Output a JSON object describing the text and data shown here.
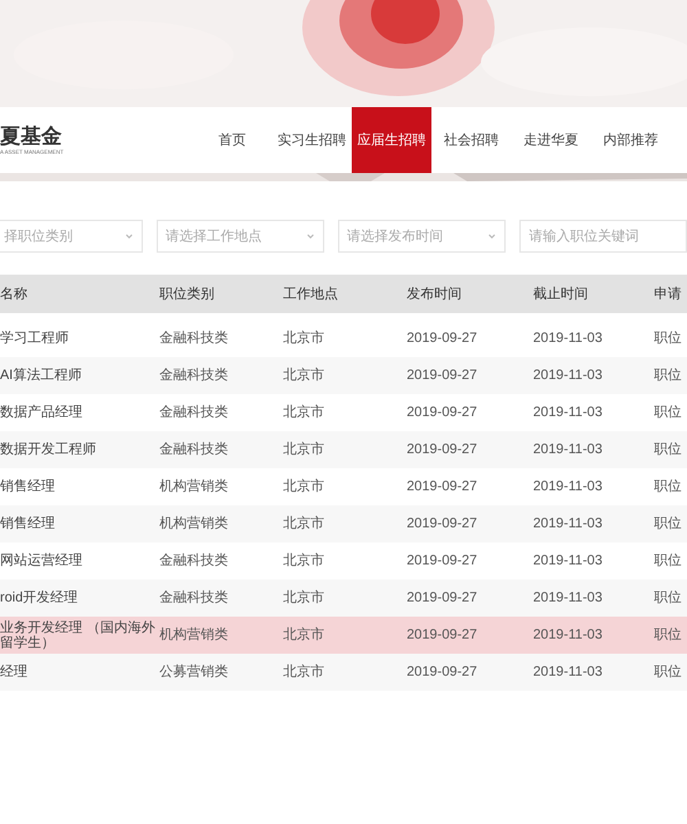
{
  "logo": {
    "name": "夏基金",
    "tagline": "A ASSET MANAGEMENT"
  },
  "nav": [
    {
      "label": "首页",
      "selected": false
    },
    {
      "label": "实习生招聘",
      "selected": false
    },
    {
      "label": "应届生招聘",
      "selected": true
    },
    {
      "label": "社会招聘",
      "selected": false
    },
    {
      "label": "走进华夏",
      "selected": false
    },
    {
      "label": "内部推荐",
      "selected": false
    }
  ],
  "filters": [
    {
      "kind": "select",
      "placeholder": "择职位类别"
    },
    {
      "kind": "select",
      "placeholder": "请选择工作地点"
    },
    {
      "kind": "select",
      "placeholder": "请选择发布时间"
    },
    {
      "kind": "text",
      "placeholder": "请输入职位关键词"
    }
  ],
  "table": {
    "columns": [
      "名称",
      "职位类别",
      "工作地点",
      "发布时间",
      "截止时间",
      "申请"
    ],
    "rows": [
      {
        "cells": [
          "学习工程师",
          "金融科技类",
          "北京市",
          "2019-09-27",
          "2019-11-03",
          "职位"
        ],
        "selected": false
      },
      {
        "cells": [
          "AI算法工程师",
          "金融科技类",
          "北京市",
          "2019-09-27",
          "2019-11-03",
          "职位"
        ],
        "selected": false
      },
      {
        "cells": [
          "数据产品经理",
          "金融科技类",
          "北京市",
          "2019-09-27",
          "2019-11-03",
          "职位"
        ],
        "selected": false
      },
      {
        "cells": [
          "数据开发工程师",
          "金融科技类",
          "北京市",
          "2019-09-27",
          "2019-11-03",
          "职位"
        ],
        "selected": false
      },
      {
        "cells": [
          "销售经理",
          "机构营销类",
          "北京市",
          "2019-09-27",
          "2019-11-03",
          "职位"
        ],
        "selected": false
      },
      {
        "cells": [
          "销售经理",
          "机构营销类",
          "北京市",
          "2019-09-27",
          "2019-11-03",
          "职位"
        ],
        "selected": false
      },
      {
        "cells": [
          "网站运营经理",
          "金融科技类",
          "北京市",
          "2019-09-27",
          "2019-11-03",
          "职位"
        ],
        "selected": false
      },
      {
        "cells": [
          "roid开发经理",
          "金融科技类",
          "北京市",
          "2019-09-27",
          "2019-11-03",
          "职位"
        ],
        "selected": false
      },
      {
        "cells": [
          "业务开发经理 （国内海外留学生）",
          "机构营销类",
          "北京市",
          "2019-09-27",
          "2019-11-03",
          "职位"
        ],
        "selected": true
      },
      {
        "cells": [
          "经理",
          "公募营销类",
          "北京市",
          "2019-09-27",
          "2019-11-03",
          "职位"
        ],
        "selected": false
      }
    ]
  }
}
